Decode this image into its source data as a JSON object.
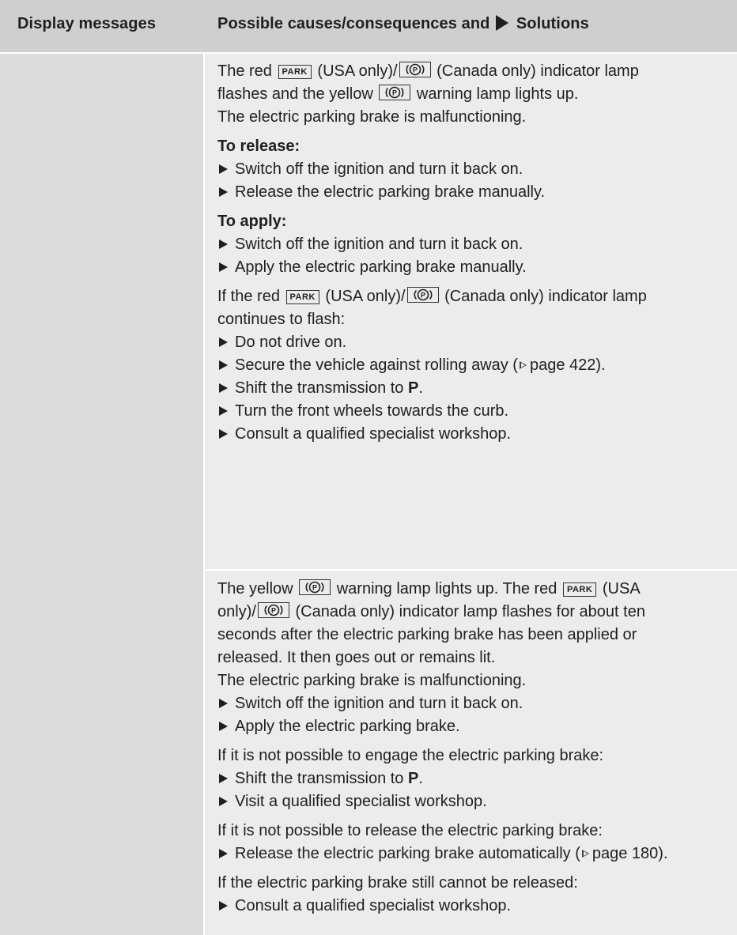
{
  "header": {
    "col1": "Display messages",
    "col2_a": "Possible causes/consequences and",
    "col2_b": "Solutions"
  },
  "section1": {
    "l1_a": "The red",
    "park": "PARK",
    "l1_b": "(USA only)/",
    "l1_c": "(Canada only) indicator lamp",
    "l2_a": "flashes and the yellow",
    "l2_b": "warning lamp lights up.",
    "l3": "The electric parking brake is malfunctioning.",
    "release_heading": "To release:",
    "release_steps": [
      "Switch off the ignition and turn it back on.",
      "Release the electric parking brake manually."
    ],
    "apply_heading": "To apply:",
    "apply_steps": [
      "Switch off the ignition and turn it back on.",
      "Apply the electric parking brake manually."
    ],
    "cont_a": "If the red",
    "cont_b": "(USA only)/",
    "cont_c": "(Canada only) indicator lamp",
    "cont_d": "continues to flash:",
    "b_drive": "Do not drive on.",
    "b_secure": "Secure the vehicle against rolling away (",
    "b_secure_page": "page 422).",
    "b_shift_a": "Shift the transmission to",
    "b_shift_p": "P",
    "b_shift_c": ".",
    "b_turn": "Turn the front wheels towards the curb.",
    "b_consult": "Consult a qualified specialist workshop."
  },
  "section2": {
    "l1_a": "The yellow",
    "l1_b": "warning lamp lights up. The red",
    "l1_c": "(USA",
    "l2_a": "only)/",
    "l2_b": "(Canada only) indicator lamp flashes for about ten",
    "l3": "seconds after the electric parking brake has been applied or",
    "l4": "released. It then goes out or remains lit.",
    "l5": "The electric parking brake is malfunctioning.",
    "s1": "Switch off the ignition and turn it back on.",
    "s2": "Apply the electric parking brake.",
    "engage": "If it is not possible to engage the electric parking brake:",
    "shift_a": "Shift the transmission to",
    "shift_p": "P",
    "shift_c": ".",
    "visit": "Visit a qualified specialist workshop.",
    "release_q": "If it is not possible to release the electric parking brake:",
    "auto_a": "Release the electric parking brake automatically (",
    "auto_page": "page 180).",
    "still": "If the electric parking brake still cannot be released:",
    "consult": "Consult a qualified specialist workshop."
  },
  "colors": {
    "header_bg": "#cfcfcf",
    "left_bg": "#dcdcdc",
    "right_bg": "#ececec"
  },
  "icons": [
    "park-indicator-icon",
    "parking-brake-p-icon",
    "solution-arrow-icon",
    "page-reference-icon"
  ]
}
